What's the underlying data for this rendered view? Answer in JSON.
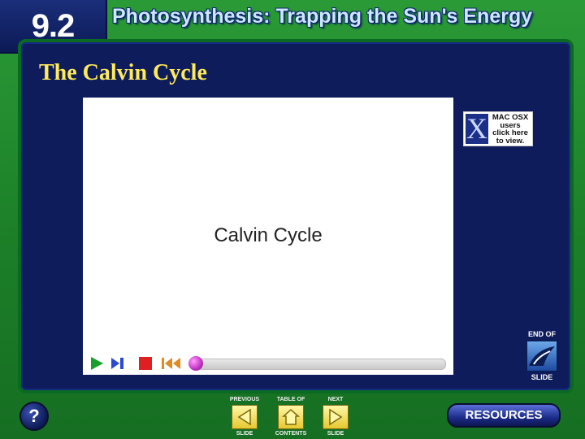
{
  "header": {
    "section_number": "9.2",
    "section_title": "Photosynthesis: Trapping the Sun's Energy"
  },
  "slide": {
    "heading": "The Calvin Cycle"
  },
  "movie": {
    "title": "Calvin Cycle",
    "controls": [
      "play-icon",
      "step-forward-icon",
      "stop-icon",
      "rewind-icon"
    ],
    "progress_fraction": 0.0
  },
  "mac_badge": {
    "letter": "X",
    "lines": [
      "MAC OSX",
      "users",
      "click here",
      "to view."
    ]
  },
  "end_of_slide": {
    "top_label": "END OF",
    "bottom_label": "SLIDE"
  },
  "footer": {
    "help_label": "?",
    "previous": {
      "top": "PREVIOUS",
      "bottom": "SLIDE"
    },
    "contents": {
      "top": "TABLE OF",
      "bottom": "CONTENTS"
    },
    "next": {
      "top": "NEXT",
      "bottom": "SLIDE"
    },
    "resources_label": "RESOURCES"
  },
  "colors": {
    "frame_green": "#1f8a2c",
    "panel_navy": "#0e1c5c",
    "heading_yellow": "#ffea5a",
    "nav_button_yellow": "#e6c830"
  }
}
